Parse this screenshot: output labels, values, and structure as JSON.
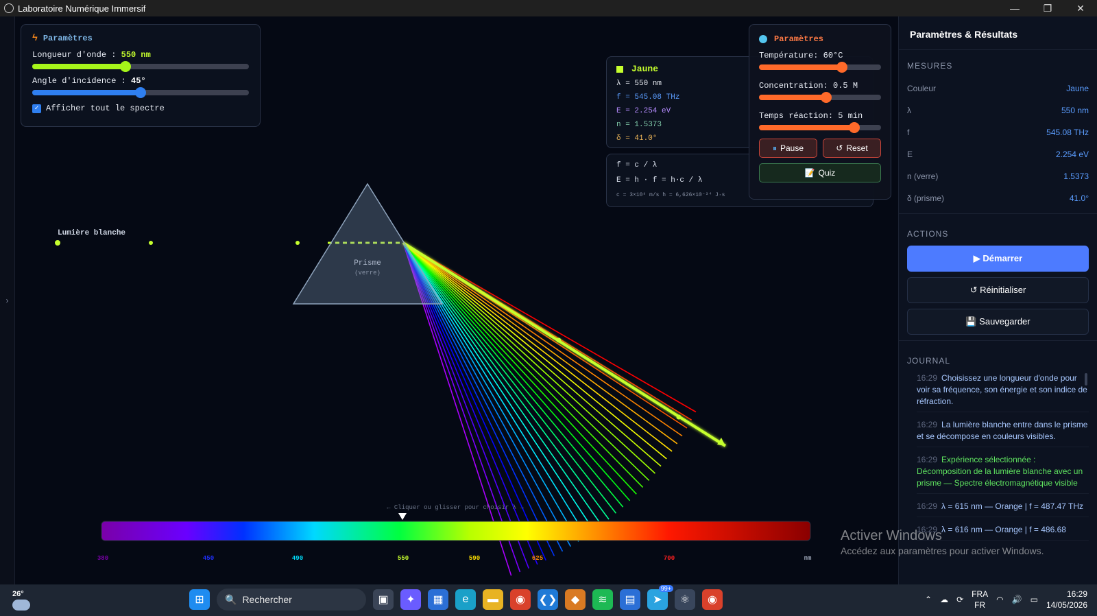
{
  "window": {
    "title": "Laboratoire Numérique Immersif",
    "minimize": "—",
    "maximize": "❐",
    "close": "✕"
  },
  "params": {
    "title": "Paramètres",
    "wavelength_label": "Longueur d'onde :",
    "wavelength_value": "550 nm",
    "wavelength_fraction": 0.43,
    "angle_label": "Angle d'incidence :",
    "angle_value": "45°",
    "angle_fraction": 0.5,
    "show_spectrum_label": "Afficher tout le spectre",
    "show_spectrum_checked": true
  },
  "info": {
    "color_name": "Jaune",
    "lambda": "λ  = 550 nm",
    "freq": "f  = 545.08 THz",
    "energy": "E  = 2.254 eV",
    "index": "n  = 1.5373",
    "deviation": "δ  = 41.0°"
  },
  "formulas": {
    "f": "f = c / λ",
    "e": "E = h · f = h·c / λ",
    "constants": "c = 3×10⁸ m/s    h = 6,626×10⁻³⁴ J·s"
  },
  "controls": {
    "title": "Paramètres",
    "temperature_label": "Température: 60°C",
    "temperature_fraction": 0.68,
    "concentration_label": "Concentration: 0.5 M",
    "concentration_fraction": 0.55,
    "time_label": "Temps réaction: 5 min",
    "time_fraction": 0.78,
    "pause_label": "Pause",
    "reset_label": "Reset",
    "quiz_label": "Quiz"
  },
  "scene": {
    "white_light_label": "Lumière blanche",
    "prism_label": "Prisme",
    "prism_sub": "(verre)",
    "spectrum_hint": "← Cliquer ou glisser pour choisir λ →",
    "spectrum_ticks": [
      "380",
      "450",
      "490",
      "550",
      "590",
      "625",
      "700",
      "nm"
    ],
    "selected_wavelength": 550,
    "beam_color": "#c6ff2e"
  },
  "sidebar": {
    "title": "Paramètres & Résultats",
    "measures_heading": "MESURES",
    "measures": [
      {
        "label": "Couleur",
        "value": "Jaune"
      },
      {
        "label": "λ",
        "value": "550 nm"
      },
      {
        "label": "f",
        "value": "545.08 THz"
      },
      {
        "label": "E",
        "value": "2.254 eV"
      },
      {
        "label": "n (verre)",
        "value": "1.5373"
      },
      {
        "label": "δ (prisme)",
        "value": "41.0°"
      }
    ],
    "actions_heading": "ACTIONS",
    "start_label": "▶ Démarrer",
    "reinit_label": "↺ Réinitialiser",
    "save_label": "💾 Sauvegarder",
    "journal_heading": "JOURNAL",
    "journal": [
      {
        "time": "16:29",
        "msg": "Choisissez une longueur d'onde pour voir sa fréquence, son énergie et son indice de réfraction.",
        "kind": "blue"
      },
      {
        "time": "16:29",
        "msg": "La lumière blanche entre dans le prisme et se décompose en couleurs visibles.",
        "kind": "blue"
      },
      {
        "time": "16:29",
        "msg": "Expérience sélectionnée : Décomposition de la lumière blanche avec un prisme — Spectre électromagnétique visible",
        "kind": "green"
      },
      {
        "time": "16:29",
        "msg": "λ = 615 nm — Orange | f = 487.47 THz",
        "kind": "blue"
      },
      {
        "time": "16:29",
        "msg": "λ = 616 nm — Orange | f = 486.68",
        "kind": "blue"
      }
    ]
  },
  "watermark": {
    "line1": "Activer Windows",
    "line2": "Accédez aux paramètres pour activer Windows."
  },
  "taskbar": {
    "temperature": "26°",
    "search_placeholder": "Rechercher",
    "lang1": "FRA",
    "lang2": "FR",
    "time": "16:29",
    "date": "14/05/2026",
    "badge_count": "99+"
  }
}
